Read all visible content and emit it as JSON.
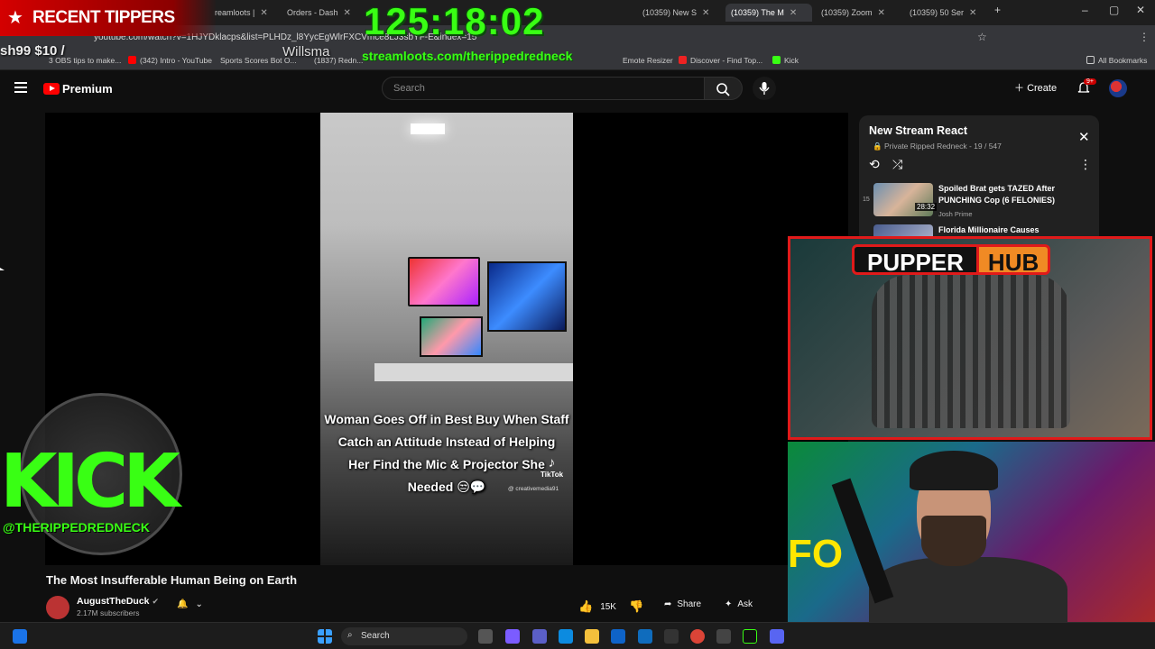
{
  "browser": {
    "tabs": [
      {
        "label": "reamloots |"
      },
      {
        "label": "Orders - Dash"
      },
      {
        "label": "(10359) New S"
      },
      {
        "label": "(10359) The M"
      },
      {
        "label": "(10359) Zoom"
      },
      {
        "label": "(10359) 50 Ser"
      }
    ],
    "url": "youtube.com/watch?v=1HJYDklacps&list=PLHDz_l8YycEgWlrFXCVmce8LJ3sbYF-E&index=15",
    "bookmarks": [
      {
        "label": "3 OBS tips to make..."
      },
      {
        "label": "(342) Intro - YouTube"
      },
      {
        "label": "Sports Scores Bot O..."
      },
      {
        "label": "(1837) Redn..."
      },
      {
        "label": "Emote Resizer"
      },
      {
        "label": "Discover - Find Top..."
      },
      {
        "label": "Kick"
      },
      {
        "label": "All Bookmarks"
      }
    ]
  },
  "youtube": {
    "brand": "Premium",
    "search_placeholder": "Search",
    "create_label": "Create",
    "notif_badge": "9+",
    "video": {
      "caption_lines": [
        "Woman Goes Off in Best Buy When Staff",
        "Catch an Attitude Instead of Helping",
        "Her Find the Mic & Projector She",
        "Needed 😒💬"
      ],
      "watermark": "TikTok",
      "watermark_handle": "@ creativemedia91",
      "title": "The Most Insufferable Human Being on Earth",
      "channel": "AugustTheDuck",
      "subscribers": "2.17M subscribers",
      "likes": "15K",
      "share_label": "Share",
      "ask_label": "Ask"
    },
    "playlist": {
      "title": "New Stream React",
      "subtitle": "Private Ripped Redneck - 19 / 547",
      "items": [
        {
          "index": "15",
          "duration": "28:32",
          "title": "Spoiled Brat gets TAZED After PUNCHING Cop (6 FELONIES)",
          "channel": "Josh Prime"
        },
        {
          "title": "Florida Millionaire Causes"
        }
      ]
    }
  },
  "overlays": {
    "recent_tippers": "RECENT TIPPERS",
    "ticker": "sh99 $10 /",
    "ticker_name": "Willsma",
    "timer": "125:18:02",
    "stream_url": "streamloots.com/therippedredneck",
    "kick_word": "KICK",
    "kick_handle": "@THERIPPEDREDNECK",
    "pupper_word": "PUPPER",
    "pupper_hub": "HUB",
    "fo_text": "FO"
  },
  "taskbar": {
    "search_label": "Search"
  },
  "colors": {
    "accent_green": "#39ff14",
    "accent_red": "#e01a1a",
    "youtube_red": "#ff0000",
    "pupper_orange": "#f08a24"
  }
}
